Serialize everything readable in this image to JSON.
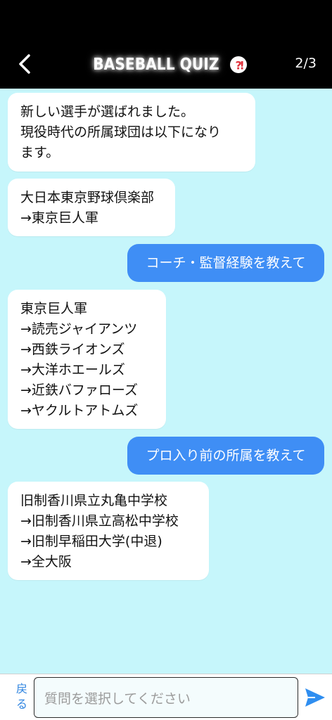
{
  "header": {
    "title": "BASEBALL QUIZ",
    "progress": "2/3"
  },
  "messages": [
    {
      "role": "bot",
      "text": "新しい選手が選ばれました。\n現役時代の所属球団は以下になり\nます。"
    },
    {
      "role": "bot",
      "text": "大日本東京野球倶楽部\n →東京巨人軍"
    },
    {
      "role": "user",
      "text": "コーチ・監督経験を教えて"
    },
    {
      "role": "bot",
      "text": "東京巨人軍\n →読売ジャイアンツ\n →西鉄ライオンズ\n →大洋ホエールズ\n →近鉄バファローズ\n →ヤクルトアトムズ"
    },
    {
      "role": "user",
      "text": "プロ入り前の所属を教えて"
    },
    {
      "role": "bot",
      "text": "旧制香川県立丸亀中学校\n →旧制香川県立高松中学校\n →旧制早稲田大学(中退)\n →全大阪"
    }
  ],
  "footer": {
    "back_label": "戻る",
    "input_placeholder": "質問を選択してください"
  },
  "colors": {
    "background": "#c6f6fb",
    "header": "#000000",
    "user_bubble": "#3f8ef5",
    "bot_bubble": "#ffffff",
    "send_icon": "#2f8ef0",
    "back_text": "#2f84e0"
  },
  "icons": {
    "back": "chevron-left-icon",
    "title_badge": "question-exclamation-icon",
    "send": "send-icon"
  }
}
